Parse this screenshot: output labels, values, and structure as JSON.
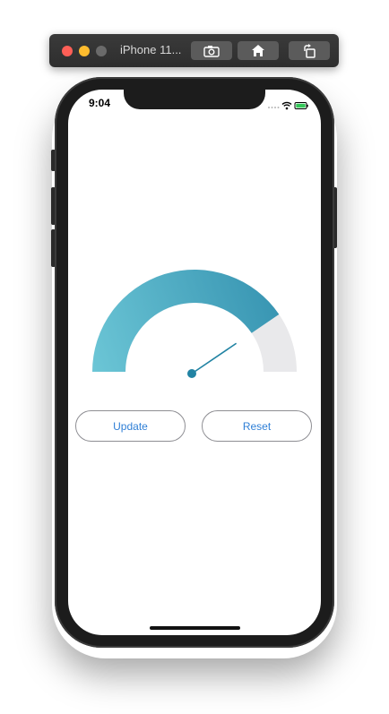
{
  "simulator": {
    "window_title": "iPhone 11...",
    "buttons": [
      {
        "icon": "camera-icon"
      },
      {
        "icon": "home-icon"
      },
      {
        "icon": "rotate-icon"
      }
    ]
  },
  "status_bar": {
    "time": "9:04",
    "icons": [
      "signal-dots-icon",
      "wifi-icon",
      "battery-icon"
    ]
  },
  "gauge": {
    "value_fraction": 0.81,
    "fill_fraction": 0.81,
    "colors": {
      "start": "#6cc6d6",
      "end": "#3996b3",
      "track": "#e9e9eb",
      "needle": "#2183a3"
    }
  },
  "actions": {
    "update_label": "Update",
    "reset_label": "Reset",
    "accent_color": "#2f7fd6"
  }
}
